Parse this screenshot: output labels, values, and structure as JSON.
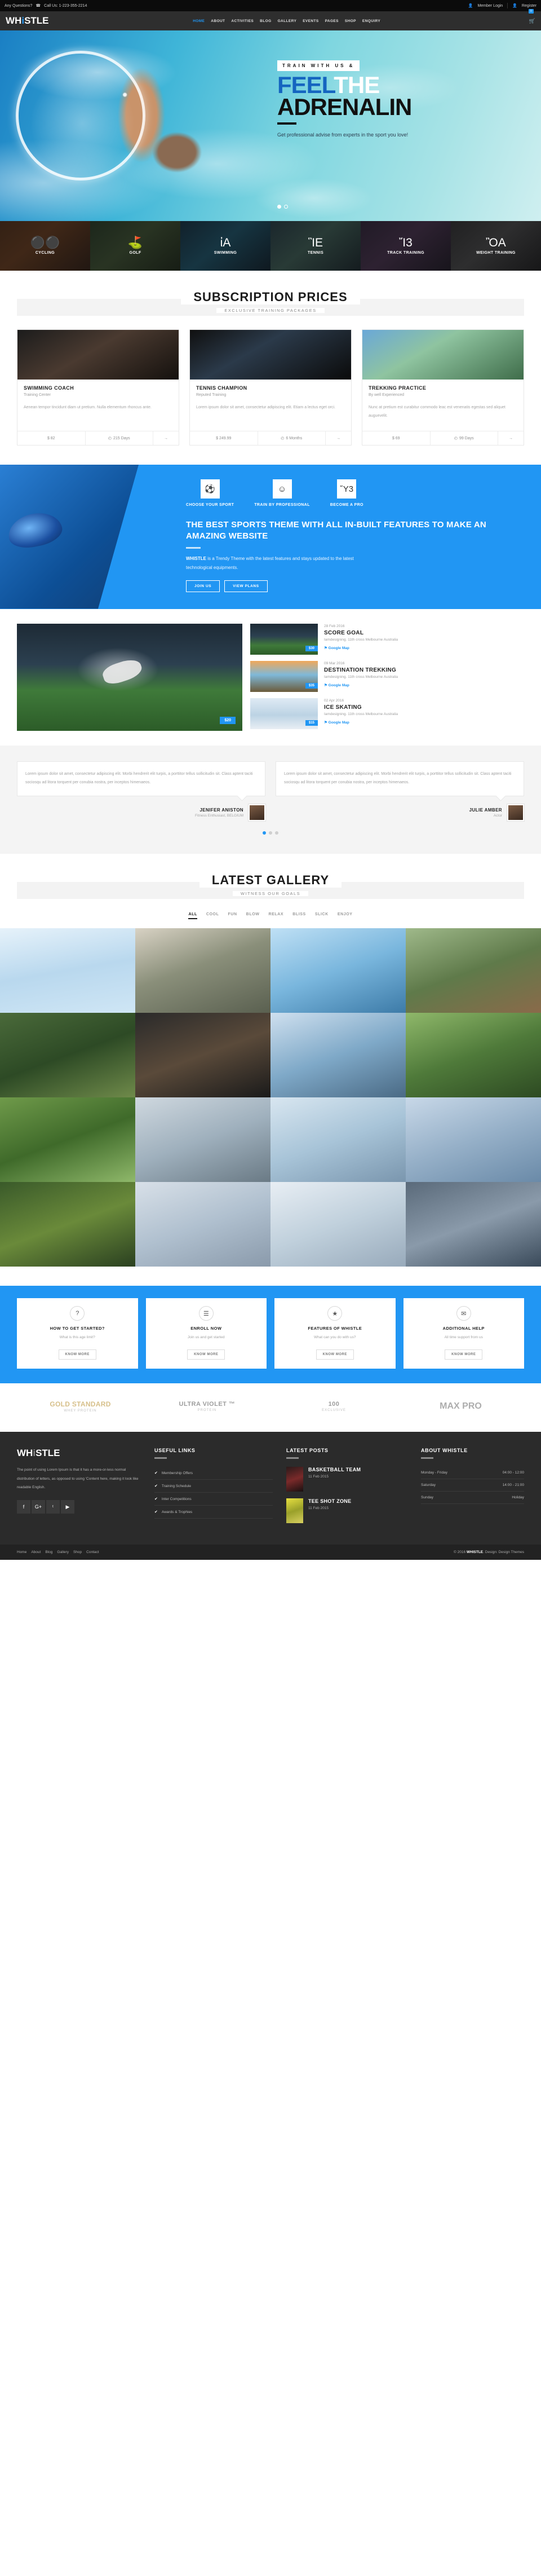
{
  "topbar": {
    "question": "Any Questions?",
    "phone_icon": "phone-icon",
    "phone": "Call Us: 1-223-355-2214",
    "member_login": "Member Login",
    "register": "Register"
  },
  "nav": {
    "logo_a": "WH",
    "logo_i": "i",
    "logo_b": "STLE",
    "items": [
      {
        "label": "HOME",
        "active": true
      },
      {
        "label": "ABOUT",
        "active": false
      },
      {
        "label": "ACTIVITIES",
        "active": false
      },
      {
        "label": "BLOG",
        "active": false
      },
      {
        "label": "GALLERY",
        "active": false
      },
      {
        "label": "EVENTS",
        "active": false
      },
      {
        "label": "PAGES",
        "active": false
      },
      {
        "label": "SHOP",
        "active": false
      },
      {
        "label": "ENQUIRY",
        "active": false
      }
    ],
    "cart_count": "0"
  },
  "hero": {
    "kicker": "TRAIN WITH US &",
    "line1_blue": "FEEL",
    "line1_white": "THE",
    "line2": "ADRENALIN",
    "sub": "Get professional advise from experts in the sport you love!"
  },
  "activities": [
    {
      "label": "CYCLING",
      "icon": "cycling-icon",
      "glyph": "Ὣ4"
    },
    {
      "label": "GOLF",
      "icon": "golf-icon",
      "glyph": "G"
    },
    {
      "label": "SWIMMING",
      "icon": "swimming-icon",
      "glyph": "S"
    },
    {
      "label": "TENNIS",
      "icon": "tennis-icon",
      "glyph": "T"
    },
    {
      "label": "TRACK TRAINING",
      "icon": "running-icon",
      "glyph": "R"
    },
    {
      "label": "WEIGHT TRAINING",
      "icon": "weights-icon",
      "glyph": "W"
    }
  ],
  "pricing": {
    "title": "SUBSCRIPTION PRICES",
    "subtitle": "EXCLUSIVE TRAINING PACKAGES",
    "cards": [
      {
        "name": "SWIMMING COACH",
        "sub": "Training Center",
        "desc": "Aenean tempor tincidunt diam ut pretium. Nulla elementum rhoncus ante.",
        "price": "$ 82",
        "duration": "215 Days",
        "clock_icon": "clock-icon",
        "arrow": "→"
      },
      {
        "name": "TENNIS CHAMPION",
        "sub": "Reputed Training",
        "desc": "Lorem ipsum dolor sit amet, consectetur adipiscing elit. Etiam a lectus eget orci.",
        "price": "$ 249.99",
        "duration": "6 Months",
        "clock_icon": "clock-icon",
        "arrow": "→"
      },
      {
        "name": "TREKKING PRACTICE",
        "sub": "By well Experienced",
        "desc": "Nunc at pretium est curabitur commodo leac est venenatis egestas sed aliquet auguevelit.",
        "price": "$ 69",
        "duration": "99 Days",
        "clock_icon": "clock-icon",
        "arrow": "→"
      }
    ]
  },
  "promo": {
    "features": [
      {
        "label": "CHOOSE YOUR SPORT",
        "icon": "soccer-ball-icon",
        "glyph": "⚽"
      },
      {
        "label": "TRAIN BY PROFESSIONAL",
        "icon": "coach-people-icon",
        "glyph": "♟"
      },
      {
        "label": "BECOME A PRO",
        "icon": "calendar-icon",
        "glyph": "Ὄ5"
      }
    ],
    "heading": "THE BEST SPORTS THEME WITH ALL IN-BUILT FEATURES TO MAKE AN AMAZING WEBSITE",
    "body_bold": "WHISTLE",
    "body_rest": " is a Trendy Theme with the latest features and stays updated to the latest technological equipments.",
    "btn_join": "JOIN US",
    "btn_plans": "VIEW PLANS"
  },
  "events": {
    "featured_price": "$20",
    "items": [
      {
        "date": "28 Feb 2016",
        "title": "SCORE GOAL",
        "address": "Iamdesigning. 11th cross Melbourne Australia",
        "map": "Google Map",
        "map_icon": "map-pin-icon",
        "price": "$30"
      },
      {
        "date": "09 Mar 2016",
        "title": "DESTINATION TREKKING",
        "address": "Iamdesigning. 11th cross Melbourne Australia",
        "map": "Google Map",
        "map_icon": "map-pin-icon",
        "price": "$35"
      },
      {
        "date": "02 Apr 2016",
        "title": "ICE SKATING",
        "address": "Iamdesigning. 11th cross Melbourne Australia",
        "map": "Google Map",
        "map_icon": "map-pin-icon",
        "price": "$15"
      }
    ]
  },
  "testimonials": {
    "items": [
      {
        "quote": "Lorem ipsum dolor sit amet, consectetur adipiscing elit. Morbi hendrerit elit turpis, a porttitor tellus sollicitudin sit. Class aptent taciti sociosqu ad litora torquent per conubia nostra, per inceptos himenaeos.",
        "name": "JENIFER ANISTON",
        "role": "Fitness Enthusiast, BELGIUM"
      },
      {
        "quote": "Lorem ipsum dolor sit amet, consectetur adipiscing elit. Morbi hendrerit elit turpis, a porttitor tellus sollicitudin sit. Class aptent taciti sociosqu ad litora torquent per conubia nostra, per inceptos himenaeos.",
        "name": "JULIE AMBER",
        "role": "Actor"
      }
    ],
    "dots": 3,
    "active_dot": 0
  },
  "gallery": {
    "title": "LATEST GALLERY",
    "subtitle": "WITNESS OUR GOALS",
    "filters": [
      {
        "label": "ALL",
        "active": true
      },
      {
        "label": "COOL",
        "active": false
      },
      {
        "label": "FUN",
        "active": false
      },
      {
        "label": "BLOW",
        "active": false
      },
      {
        "label": "RELAX",
        "active": false
      },
      {
        "label": "BLISS",
        "active": false
      },
      {
        "label": "SLICK",
        "active": false
      },
      {
        "label": "ENJOY",
        "active": false
      }
    ]
  },
  "help": {
    "cards": [
      {
        "icon": "question-icon",
        "glyph": "?",
        "title": "HOW TO GET STARTED?",
        "desc": "What is this age limit?",
        "btn": "KNOW MORE"
      },
      {
        "icon": "person-icon",
        "glyph": "☰",
        "title": "ENROLL NOW",
        "desc": "Join us and get started",
        "btn": "KNOW MORE"
      },
      {
        "icon": "star-icon",
        "glyph": "★",
        "title": "FEATURES OF WHISTLE",
        "desc": "What can you do with us?",
        "btn": "KNOW MORE"
      },
      {
        "icon": "support-icon",
        "glyph": "✉",
        "title": "ADDITIONAL HELP",
        "desc": "All time support from us",
        "btn": "KNOW MORE"
      }
    ]
  },
  "brands": [
    {
      "line1": "GOLD STANDARD",
      "line2": "WHEY PROTEIN",
      "style": "gold"
    },
    {
      "line1": "ULTRA VIOLET ™",
      "line2": "PROTEIN",
      "style": "plain"
    },
    {
      "line1": "100",
      "line2": "EXCLUSIVE",
      "style": "hundred"
    },
    {
      "line1": "MAX PRO",
      "line2": "",
      "style": "big"
    }
  ],
  "footer": {
    "logo_a": "WH",
    "logo_i": "i",
    "logo_b": "STLE",
    "about_text": "The point of using Lorem Ipsum is that it has a more-or-less normal distribution of letters, as opposed to using 'Content here, making it look like readable English.",
    "socials": [
      {
        "name": "facebook-icon",
        "glyph": "f"
      },
      {
        "name": "google-plus-icon",
        "glyph": "G+"
      },
      {
        "name": "twitter-icon",
        "glyph": "ᵗ"
      },
      {
        "name": "youtube-icon",
        "glyph": "▶"
      }
    ],
    "useful_links_title": "USEFUL LINKS",
    "useful_links": [
      {
        "label": "Membership Offers",
        "icon": "check-icon"
      },
      {
        "label": "Training Schedule",
        "icon": "check-icon"
      },
      {
        "label": "Inter Competitions",
        "icon": "check-icon"
      },
      {
        "label": "Awards & Trophies",
        "icon": "check-icon"
      }
    ],
    "latest_posts_title": "LATEST POSTS",
    "latest_posts": [
      {
        "title": "BASKETBALL TEAM",
        "date": "11 Feb 2015"
      },
      {
        "title": "TEE SHOT ZONE",
        "date": "11 Feb 2015"
      }
    ],
    "about_title": "ABOUT WHISTLE",
    "hours": [
      {
        "day": "Monday - Friday",
        "time": "04:00 - 12:00"
      },
      {
        "day": "Saturday",
        "time": "14:00 - 21:00"
      },
      {
        "day": "Sunday",
        "time": "Holiday"
      }
    ],
    "bottom_links": [
      "Home",
      "About",
      "Blog",
      "Gallery",
      "Shop",
      "Contact"
    ],
    "copyright_pre": "© 2016 ",
    "copyright_brand": "WHISTLE",
    "copyright_post": ". Design: Design Themes"
  },
  "colors": {
    "accent": "#2196f3",
    "dark": "#2b2b2b",
    "nav": "#2e2e2e",
    "topbar": "#0b0b0b"
  }
}
